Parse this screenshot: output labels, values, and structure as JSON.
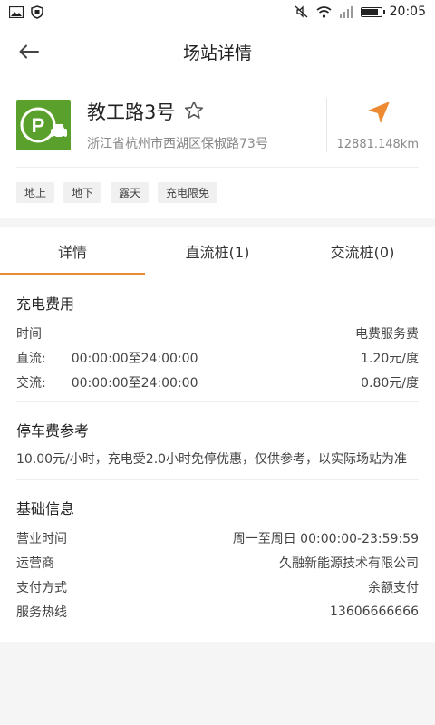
{
  "status_bar": {
    "time": "20:05",
    "battery_level": 0.9
  },
  "header": {
    "title": "场站详情"
  },
  "station": {
    "name": "教工路3号",
    "address": "浙江省杭州市西湖区保俶路73号",
    "distance": "12881.148km",
    "tags": [
      "地上",
      "地下",
      "露天",
      "充电限免"
    ],
    "logo_color": "#5aa02c",
    "nav_color": "#ee8a32"
  },
  "tabs": [
    {
      "label": "详情"
    },
    {
      "label": "直流桩(1)"
    },
    {
      "label": "交流桩(0)"
    }
  ],
  "fees": {
    "title": "充电费用",
    "header_left": "时间",
    "header_right": "电费服务费",
    "rows": [
      {
        "type": "直流:",
        "time": "00:00:00至24:00:00",
        "price": "1.20元/度"
      },
      {
        "type": "交流:",
        "time": "00:00:00至24:00:00",
        "price": "0.80元/度"
      }
    ]
  },
  "parking": {
    "title": "停车费参考",
    "note": "10.00元/小时，充电受2.0小时免停优惠，仅供参考，以实际场站为准"
  },
  "basic": {
    "title": "基础信息",
    "rows": [
      {
        "label": "营业时间",
        "value": "周一至周日 00:00:00-23:59:59"
      },
      {
        "label": "运营商",
        "value": "久融新能源技术有限公司"
      },
      {
        "label": "支付方式",
        "value": "余额支付"
      },
      {
        "label": "服务热线",
        "value": "13606666666"
      }
    ]
  }
}
